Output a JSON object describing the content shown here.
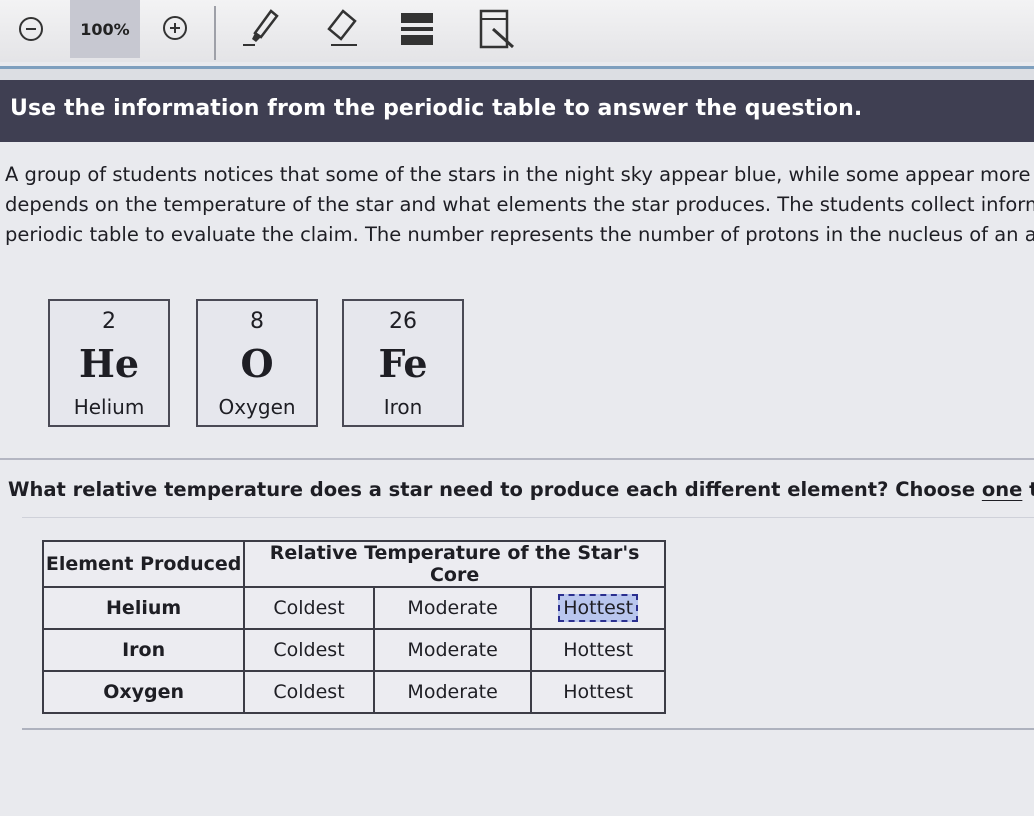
{
  "toolbar": {
    "zoom_level": "100%",
    "icons": {
      "zoom_out": "minus-circle-icon",
      "zoom_in": "plus-circle-icon",
      "highlighter": "highlighter-icon",
      "eraser": "eraser-icon",
      "line_reader": "line-reader-icon",
      "reference": "reference-sheet-icon"
    }
  },
  "instruction": "Use the information from the periodic table to answer the question.",
  "passage": {
    "lines": [
      "A group of students notices that some of the stars in the night sky appear blue, while some appear more r",
      "depends on the temperature of the star and what elements the star produces. The students collect inform",
      "periodic table to evaluate the claim. The number represents the number of protons in the nucleus of an at"
    ]
  },
  "elements": [
    {
      "number": "2",
      "symbol": "He",
      "name": "Helium"
    },
    {
      "number": "8",
      "symbol": "O",
      "name": "Oxygen"
    },
    {
      "number": "26",
      "symbol": "Fe",
      "name": "Iron"
    }
  ],
  "question": {
    "before": "What relative temperature does a star need to produce each different element? Choose ",
    "underlined": "one",
    "after": " temperatu"
  },
  "table": {
    "headers": [
      "Element Produced",
      "Relative Temperature of the Star's Core"
    ],
    "rows": [
      {
        "element": "Helium",
        "choices": [
          "Coldest",
          "Moderate",
          "Hottest"
        ],
        "selected": "Hottest"
      },
      {
        "element": "Iron",
        "choices": [
          "Coldest",
          "Moderate",
          "Hottest"
        ],
        "selected": null
      },
      {
        "element": "Oxygen",
        "choices": [
          "Coldest",
          "Moderate",
          "Hottest"
        ],
        "selected": null
      }
    ]
  },
  "colors": {
    "instruction_bar": "#3f3f52",
    "toolbar_accent": "#7e9fbe",
    "selected_choice": "#b9c6ee"
  }
}
